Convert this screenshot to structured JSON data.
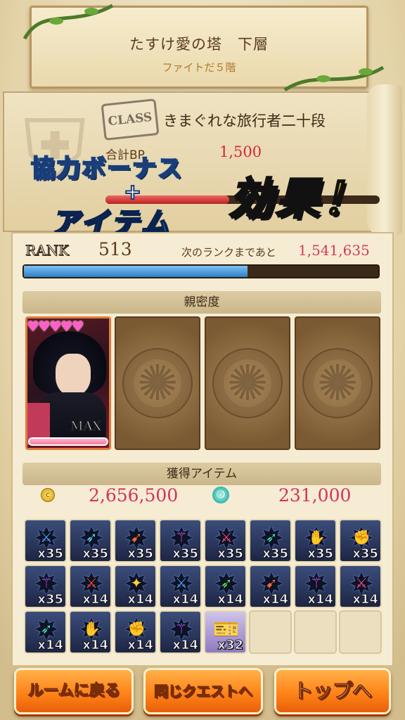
{
  "stage": {
    "title": "たすけ愛の塔　下層",
    "subtitle": "ファイトだ５階"
  },
  "class_panel": {
    "stamp": "CLASS",
    "class_name": "きまぐれな旅行者二十段",
    "bp_label": "合計BP",
    "bp_value": "1,500",
    "bp_fill_fraction": 0.45
  },
  "promo": {
    "line1": "協力ボーナス",
    "plus": "+",
    "line2": "アイテム",
    "line3": "効果！"
  },
  "rank": {
    "label": "RANK",
    "value": "513",
    "next_label": "次のランクまであと",
    "next_value": "1,541,635",
    "exp_fill_fraction": 0.63
  },
  "affinity": {
    "header": "親密度",
    "hearts": "♥♥♥♥♥",
    "max_label": "MAX",
    "affinity_fill_fraction": 1.0
  },
  "items": {
    "header": "獲得アイテム",
    "coins": "2,656,500",
    "coin_icon": "coin-icon",
    "orbs": "231,000",
    "orb_icon": "orb-icon",
    "grid": [
      {
        "qty": "x35",
        "glyph": "⚔",
        "color": "#4aa8ff"
      },
      {
        "qty": "x35",
        "glyph": "➶",
        "color": "#5ad0ff"
      },
      {
        "qty": "x35",
        "glyph": "➹",
        "color": "#ff6a3a"
      },
      {
        "qty": "x35",
        "glyph": "⚚",
        "color": "#d65aff"
      },
      {
        "qty": "x35",
        "glyph": "⚔",
        "color": "#ff4a8a"
      },
      {
        "qty": "x35",
        "glyph": "➶",
        "color": "#3ae0c0"
      },
      {
        "qty": "x35",
        "glyph": "✋",
        "color": "#9ae03a"
      },
      {
        "qty": "x35",
        "glyph": "✊",
        "color": "#ff4a8a"
      },
      {
        "qty": "x35",
        "glyph": "⚚",
        "color": "#c05aff"
      },
      {
        "qty": "x14",
        "glyph": "⚔",
        "color": "#ff4a4a"
      },
      {
        "qty": "x14",
        "glyph": "✦",
        "color": "#ffd23a"
      },
      {
        "qty": "x14",
        "glyph": "⚔",
        "color": "#4aa8ff"
      },
      {
        "qty": "x14",
        "glyph": "➶",
        "color": "#5ae05a"
      },
      {
        "qty": "x14",
        "glyph": "➹",
        "color": "#ff6a3a"
      },
      {
        "qty": "x14",
        "glyph": "⚚",
        "color": "#d65aff"
      },
      {
        "qty": "x14",
        "glyph": "⚔",
        "color": "#ff4a8a"
      },
      {
        "qty": "x14",
        "glyph": "➶",
        "color": "#3ae0c0"
      },
      {
        "qty": "x14",
        "glyph": "✋",
        "color": "#9ae03a"
      },
      {
        "qty": "x14",
        "glyph": "✊",
        "color": "#ff4a8a"
      },
      {
        "qty": "x14",
        "glyph": "⚚",
        "color": "#c05aff"
      },
      {
        "qty": "x32",
        "glyph": "",
        "color": "#6a4aa8",
        "type": "ticket"
      },
      {
        "qty": "",
        "glyph": "",
        "color": "",
        "type": "empty"
      },
      {
        "qty": "",
        "glyph": "",
        "color": "",
        "type": "empty"
      },
      {
        "qty": "",
        "glyph": "",
        "color": "",
        "type": "empty"
      }
    ]
  },
  "buttons": {
    "back_room": "ルームに戻る",
    "same_quest": "同じクエストへ",
    "top": "トップへ"
  }
}
